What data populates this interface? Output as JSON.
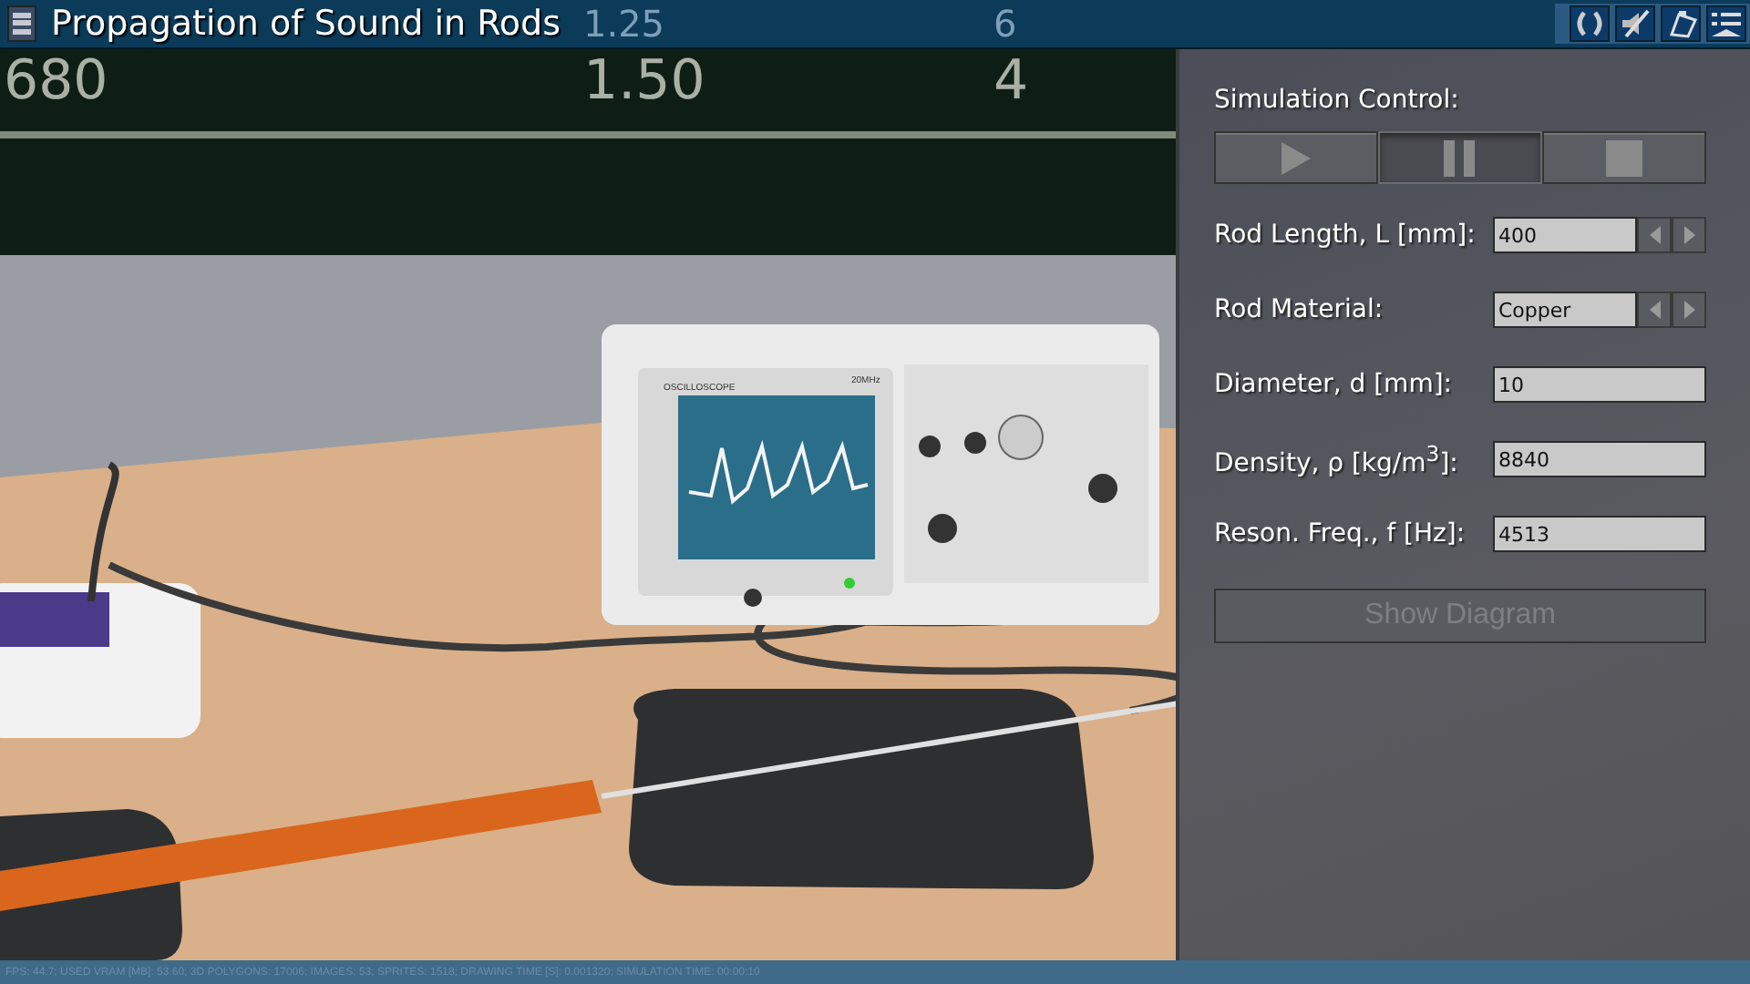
{
  "window": {
    "title": "Propagation of Sound in Rods"
  },
  "chalkboard": {
    "columns": [
      {
        "cells": [
          "680"
        ]
      },
      {
        "cells": [
          "1.25",
          "1.50"
        ]
      },
      {
        "cells": [
          "6",
          "4"
        ]
      }
    ]
  },
  "oscilloscope": {
    "label": "OSCILLOSCOPE",
    "bandwidth": "20MHz"
  },
  "simulation_control": {
    "title": "Simulation Control:",
    "buttons": [
      {
        "kind": "play",
        "selected": false
      },
      {
        "kind": "pause",
        "selected": true
      },
      {
        "kind": "stop",
        "selected": false
      }
    ]
  },
  "parameters": [
    {
      "label": "Rod Length, L [mm]:",
      "value": "400",
      "kind": "spinner"
    },
    {
      "label": "Rod Material:",
      "value": "Copper",
      "kind": "spinner"
    },
    {
      "label": "Diameter, d [mm]:",
      "value": "10",
      "kind": "field"
    },
    {
      "label": "Density, ρ [kg/m$^{3}$]:",
      "value": "8840",
      "kind": "field"
    },
    {
      "label": "Reson. Freq., f [Hz]:",
      "value": "4513",
      "kind": "field"
    }
  ],
  "show_diagram": {
    "label": "Show Diagram",
    "disabled": true
  },
  "status_bar": "FPS: 44.7; USED VRAM [MB]: 53.60; 3D POLYGONS: 17006; IMAGES: 53; SPRITES: 1518; DRAWING TIME [S]: 0.001320; SIMULATION TIME: 00:00:10"
}
